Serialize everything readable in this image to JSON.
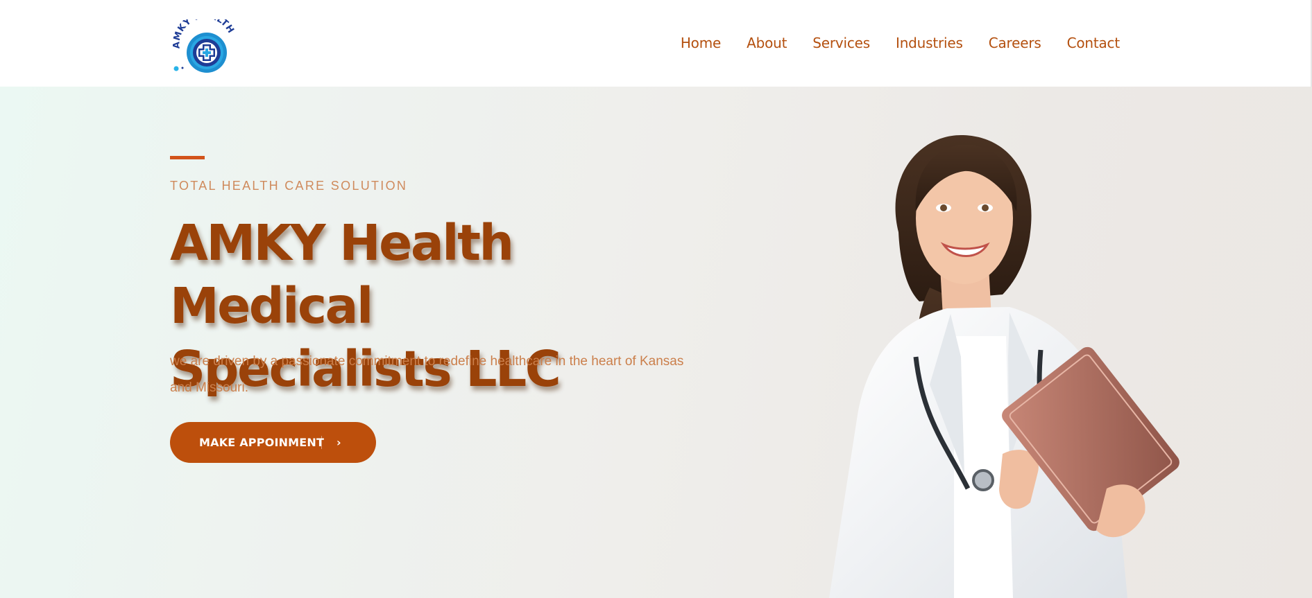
{
  "header": {
    "logo_text": "AMKY HEALTH",
    "nav": [
      "Home",
      "About",
      "Services",
      "Industries",
      "Careers",
      "Contact"
    ]
  },
  "hero": {
    "eyebrow": "TOTAL HEALTH CARE SOLUTION",
    "title_line1": "AMKY Health Medical",
    "title_line2": "Specialists LLC",
    "description": "we are driven by a passionate commitment to redefine healthcare in the heart of Kansas and Missouri.",
    "cta_label": "MAKE APPOINMENT",
    "cta_icon": "chevron-right-icon"
  },
  "colors": {
    "brand": "#b4500f",
    "title": "#9a4209",
    "button": "#bd4f0c",
    "accent_bar": "#d2531a",
    "logo_blue": "#1e3c96"
  }
}
